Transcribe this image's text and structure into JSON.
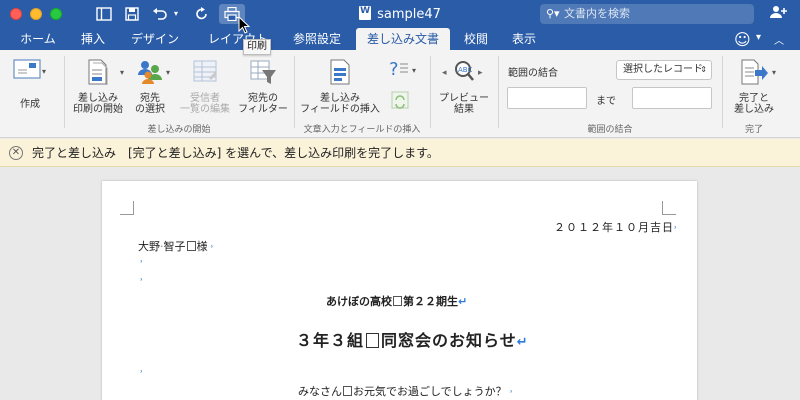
{
  "window": {
    "title": "sample47",
    "search_placeholder": "文書内を検索",
    "tooltip": "印刷"
  },
  "tabs": [
    {
      "label": "ホーム"
    },
    {
      "label": "挿入"
    },
    {
      "label": "デザイン"
    },
    {
      "label": "レイアウト"
    },
    {
      "label": "参照設定"
    },
    {
      "label": "差し込み文書"
    },
    {
      "label": "校閲"
    },
    {
      "label": "表示"
    }
  ],
  "active_tab": "差し込み文書",
  "ribbon": {
    "create": "作成",
    "start_merge": [
      "差し込み",
      "印刷の開始"
    ],
    "select_recipients": [
      "宛先",
      "の選択"
    ],
    "edit_recipients": [
      "受信者",
      "一覧の編集"
    ],
    "filter_recipients": [
      "宛先の",
      "フィルター"
    ],
    "group_start": "差し込みの開始",
    "insert_field": [
      "差し込み",
      "フィールドの挿入"
    ],
    "group_insert": "文章入力とフィールドの挿入",
    "preview": [
      "プレビュー",
      "結果"
    ],
    "range_label": "範囲の結合",
    "range_select": "選択したレコード",
    "range_to": "まで",
    "group_range": "範囲の結合",
    "finish": [
      "完了と",
      "差し込み"
    ],
    "group_finish": "完了"
  },
  "message_bar": {
    "text": "完了と差し込み　[完了と差し込み] を選んで、差し込み印刷を完了します。"
  },
  "document": {
    "date": "２０１２年１０月吉日",
    "recipient_name": "大野",
    "recipient_name2": "智子",
    "honorific": "様",
    "org": "あけぼの高校",
    "org_class": "第２２期生",
    "heading_a": "３年３組",
    "heading_b": "同窓会のお知らせ",
    "greeting_a": "みなさん",
    "greeting_b": "お元気でお過ごしでしょうか？"
  }
}
